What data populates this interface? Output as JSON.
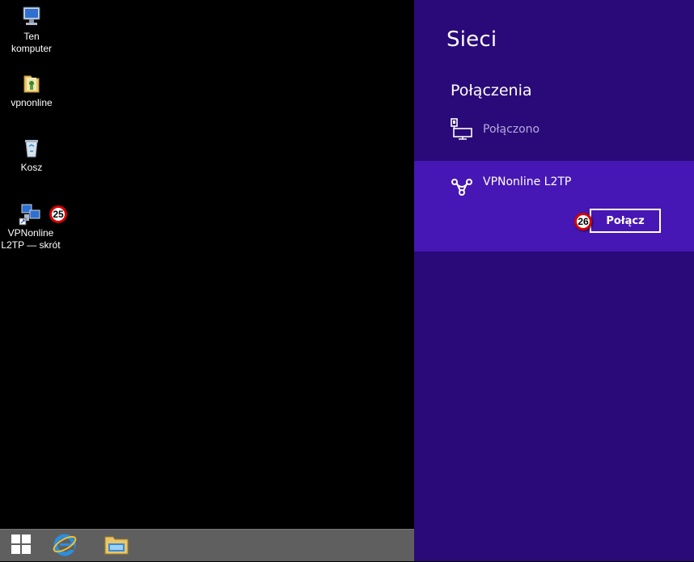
{
  "desktop": {
    "icons": [
      {
        "label": "Ten komputer"
      },
      {
        "label": "vpnonline"
      },
      {
        "label": "Kosz"
      },
      {
        "label": "VPNonline L2TP — skrót"
      }
    ],
    "badges": {
      "shortcut": "25",
      "connect": "26"
    }
  },
  "taskbar": {
    "items": [
      "start-icon",
      "internet-explorer-icon",
      "file-explorer-icon"
    ]
  },
  "charm": {
    "title": "Sieci",
    "section": "Połączenia",
    "ethernet_status": "Połączono",
    "vpn_name": "VPNonline L2TP",
    "connect_label": "Połącz",
    "colors": {
      "panel": "#2a0a78",
      "selected": "#4617b4",
      "dim_text": "#b7a8e0"
    }
  }
}
